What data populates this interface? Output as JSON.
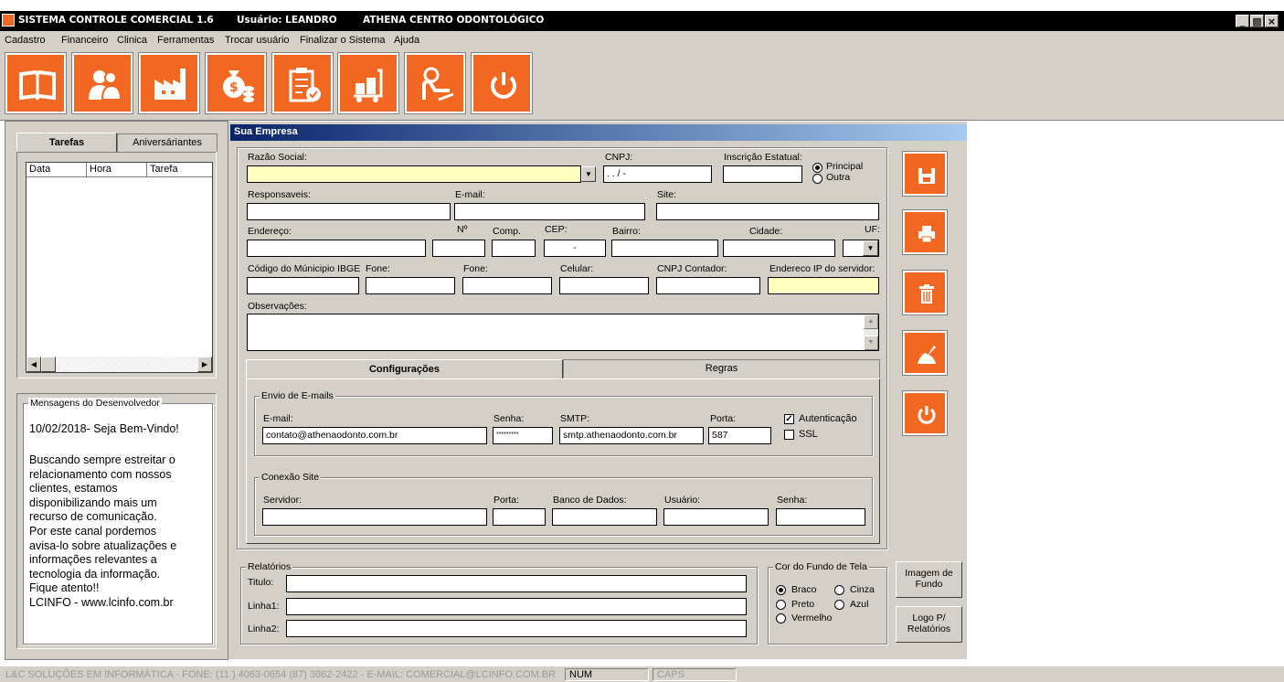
{
  "window": {
    "app_title": "SISTEMA CONTROLE COMERCIAL 1.6",
    "user": "Usuário: LEANDRO",
    "clinic": "ATHENA CENTRO ODONTOLÓGICO",
    "min": "_",
    "max": "ð",
    "close": "×"
  },
  "menu": [
    "Cadastro",
    "Financeiro",
    "Clinica",
    "Ferramentas",
    "Trocar usuário",
    "Finalizar o Sistema",
    "Ajuda"
  ],
  "toolbar_icons": [
    "book-icon",
    "users-icon",
    "factory-icon",
    "money-bag-icon",
    "checklist-icon",
    "delivery-cart-icon",
    "reception-icon",
    "power-icon"
  ],
  "left": {
    "tabs": [
      "Tarefas",
      "Aniversáriantes"
    ],
    "columns": [
      "Data",
      "Hora",
      "Tarefa"
    ],
    "messages_title": "Mensagens do Desenvolvedor",
    "messages_date": "10/02/2018- Seja Bem-Vindo!",
    "messages_body": [
      "Buscando sempre estreitar o",
      "relacionamento com nossos",
      "clientes, estamos",
      "disponibilizando mais um",
      "recurso de comunicação.",
      "Por este canal pordemos",
      "avisa-lo sobre atualizações e",
      "informações relevantes a",
      "tecnologia da informação.",
      "Fique atento!!",
      "LCINFO - www.lcinfo.com.br"
    ]
  },
  "form": {
    "title": "Sua Empresa",
    "razao_label": "Razão Social:",
    "cnpj_label": "CNPJ:",
    "cnpj_value": " .  . /  -",
    "ie_label": "Inscrição Estatual:",
    "principal": "Principal",
    "outra": "Outra",
    "resp_label": "Responsaveis:",
    "email_label": "E-mail:",
    "site_label": "Site:",
    "end_label": "Endereço:",
    "num_label": "Nº",
    "comp_label": "Comp.",
    "cep_label": "CEP:",
    "cep_value": "-",
    "bairro_label": "Bairro:",
    "cidade_label": "Cidade:",
    "uf_label": "UF:",
    "ibge_label": "Código do Múnicipio IBGE",
    "fone1_label": "Fone:",
    "fone2_label": "Fone:",
    "cel_label": "Celular:",
    "cnpjc_label": "CNPJ Contador:",
    "ip_label": "Endereco IP do servidor:",
    "obs_label": "Observações:"
  },
  "config": {
    "tab_config": "Configurações",
    "tab_regras": "Regras",
    "envio_title": "Envio de E-mails",
    "email_label": "E-mail:",
    "email_value": "contato@athenaodonto.com.br",
    "senha_label": "Senha:",
    "senha_value": "*********",
    "smtp_label": "SMTP:",
    "smtp_value": "smtp.athenaodonto.com.br",
    "porta_label": "Porta:",
    "porta_value": "587",
    "auth_label": "Autenticação",
    "ssl_label": "SSL",
    "conexao_title": "Conexão Site",
    "servidor_label": "Servidor:",
    "porta2_label": "Porta:",
    "banco_label": "Banco de Dados:",
    "usuario_label": "Usuário:",
    "senha2_label": "Senha:"
  },
  "relatorios": {
    "title": "Relatórios",
    "titulo": "Titulo:",
    "linha1": "Linha1:",
    "linha2": "Linha2:"
  },
  "cor": {
    "title": "Cor do Fundo de Tela",
    "braco": "Braco",
    "cinza": "Cinza",
    "preto": "Preto",
    "azul": "Azul",
    "vermelho": "Vermelho"
  },
  "buttons": {
    "imagem": "Imagem de Fundo",
    "logo": "Logo P/ Relatórios"
  },
  "status": {
    "company": "L&C SOLUÇÕES EM INFORMÁTICA - FONE: (11 ) 4063-0654  (87) 3862-2422 - E-MAIL: COMERCIAL@LCINFO.COM.BR",
    "num": "NUM",
    "caps": "CAPS"
  }
}
